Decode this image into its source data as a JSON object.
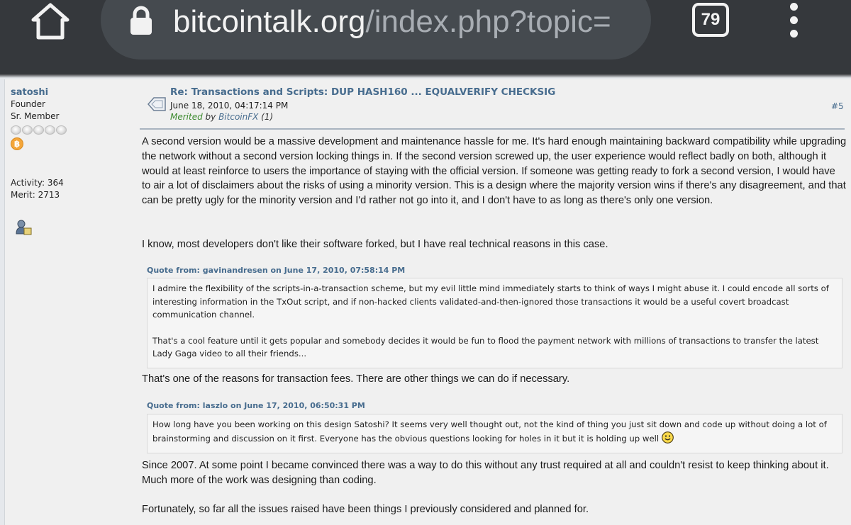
{
  "browser": {
    "url_host": "bitcointalk.org",
    "url_path": "/index.php?topic=",
    "tab_count": "79",
    "icons": [
      "home-icon",
      "lock-icon",
      "tabs-icon",
      "more-vert-icon"
    ]
  },
  "poster": {
    "name": "satoshi",
    "title": "Founder",
    "rank": "Sr. Member",
    "stars": 5,
    "activity": "Activity: 364",
    "merit": "Merit: 2713"
  },
  "post": {
    "title": "Re: Transactions and Scripts: DUP HASH160 ... EQUALVERIFY CHECKSIG",
    "date": "June 18, 2010, 04:17:14 PM",
    "merited_word": "Merited",
    "merited_by": " by ",
    "merited_user": "BitcoinFX",
    "merited_count": " (1)",
    "number": "#5",
    "paragraphs": [
      "A second version would be a massive development and maintenance hassle for me.  It's hard enough maintaining backward compatibility while upgrading the network without a second version locking things in.  If the second version screwed up, the user experience would reflect badly on both, although it would at least reinforce to users the importance of staying with the official version.  If someone was getting ready to fork a second version, I would have to air a lot of disclaimers about the risks of using a minority version.  This is a design where the majority version wins if there's any disagreement, and that can be pretty ugly for the minority version and I'd rather not go into it, and I don't have to as long as there's only one version.",
      "I know, most developers don't like their software forked, but I have real technical reasons in this case.",
      "That's one of the reasons for transaction fees.  There are other things we can do if necessary.",
      "Since 2007.  At some point I became convinced there was a way to do this without any trust required at all and couldn't resist to keep thinking about it.  Much more of the work was designing than coding.",
      "Fortunately, so far all the issues raised have been things I previously considered and planned for."
    ],
    "quotes": [
      {
        "header": "Quote from: gavinandresen on June 17, 2010, 07:58:14 PM",
        "paragraphs": [
          "I admire the flexibility of the scripts-in-a-transaction scheme, but my evil little mind immediately starts to think of ways I might abuse it.  I could encode all sorts of interesting information in the TxOut script, and if non-hacked clients validated-and-then-ignored those transactions it would be a useful covert broadcast communication channel.",
          "That's a cool feature until it gets popular and somebody decides it would be fun to flood the payment network with millions of transactions to transfer the latest Lady Gaga video to all their friends..."
        ]
      },
      {
        "header": "Quote from: laszlo on June 17, 2010, 06:50:31 PM",
        "paragraphs": [
          "How long have you been working on this design Satoshi?  It seems very well thought out, not the kind of thing you just sit down and code up without doing a lot of brainstorming and discussion on it first.  Everyone has the obvious questions looking for holes in it but it is holding up well"
        ]
      }
    ]
  }
}
